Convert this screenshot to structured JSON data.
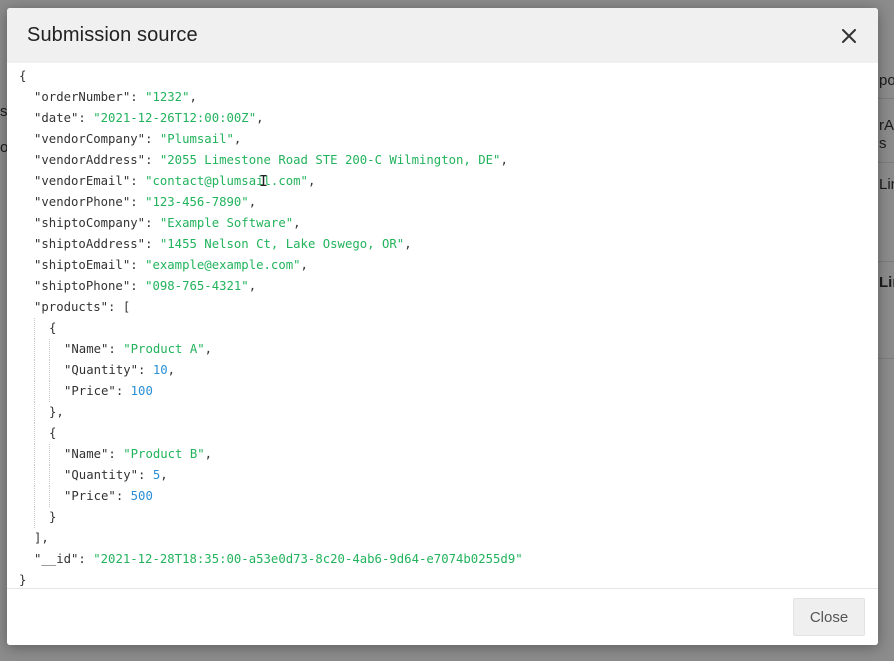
{
  "background": {
    "fragments": [
      "po",
      "rA",
      "s",
      "Lin",
      "Lin",
      "s",
      "o"
    ]
  },
  "modal": {
    "title": "Submission source",
    "close_button_label": "Close",
    "close_icon": "close-icon"
  },
  "json_source": {
    "lines": [
      {
        "depth": 0,
        "tokens": [
          {
            "t": "p",
            "v": "{"
          }
        ]
      },
      {
        "depth": 1,
        "tokens": [
          {
            "t": "k",
            "v": "\"orderNumber\""
          },
          {
            "t": "p",
            "v": ": "
          },
          {
            "t": "s",
            "v": "\"1232\""
          },
          {
            "t": "p",
            "v": ","
          }
        ]
      },
      {
        "depth": 1,
        "tokens": [
          {
            "t": "k",
            "v": "\"date\""
          },
          {
            "t": "p",
            "v": ": "
          },
          {
            "t": "s",
            "v": "\"2021-12-26T12:00:00Z\""
          },
          {
            "t": "p",
            "v": ","
          }
        ]
      },
      {
        "depth": 1,
        "tokens": [
          {
            "t": "k",
            "v": "\"vendorCompany\""
          },
          {
            "t": "p",
            "v": ": "
          },
          {
            "t": "s",
            "v": "\"Plumsail\""
          },
          {
            "t": "p",
            "v": ","
          }
        ]
      },
      {
        "depth": 1,
        "tokens": [
          {
            "t": "k",
            "v": "\"vendorAddress\""
          },
          {
            "t": "p",
            "v": ": "
          },
          {
            "t": "s",
            "v": "\"2055 Limestone Road STE 200-C Wilmington, DE\""
          },
          {
            "t": "p",
            "v": ","
          }
        ]
      },
      {
        "depth": 1,
        "tokens": [
          {
            "t": "k",
            "v": "\"vendorEmail\""
          },
          {
            "t": "p",
            "v": ": "
          },
          {
            "t": "s",
            "v": "\"contact@plumsail.com\""
          },
          {
            "t": "p",
            "v": ","
          }
        ]
      },
      {
        "depth": 1,
        "tokens": [
          {
            "t": "k",
            "v": "\"vendorPhone\""
          },
          {
            "t": "p",
            "v": ": "
          },
          {
            "t": "s",
            "v": "\"123-456-7890\""
          },
          {
            "t": "p",
            "v": ","
          }
        ]
      },
      {
        "depth": 1,
        "tokens": [
          {
            "t": "k",
            "v": "\"shiptoCompany\""
          },
          {
            "t": "p",
            "v": ": "
          },
          {
            "t": "s",
            "v": "\"Example Software\""
          },
          {
            "t": "p",
            "v": ","
          }
        ]
      },
      {
        "depth": 1,
        "tokens": [
          {
            "t": "k",
            "v": "\"shiptoAddress\""
          },
          {
            "t": "p",
            "v": ": "
          },
          {
            "t": "s",
            "v": "\"1455 Nelson Ct, Lake Oswego, OR\""
          },
          {
            "t": "p",
            "v": ","
          }
        ]
      },
      {
        "depth": 1,
        "tokens": [
          {
            "t": "k",
            "v": "\"shiptoEmail\""
          },
          {
            "t": "p",
            "v": ": "
          },
          {
            "t": "s",
            "v": "\"example@example.com\""
          },
          {
            "t": "p",
            "v": ","
          }
        ]
      },
      {
        "depth": 1,
        "tokens": [
          {
            "t": "k",
            "v": "\"shiptoPhone\""
          },
          {
            "t": "p",
            "v": ": "
          },
          {
            "t": "s",
            "v": "\"098-765-4321\""
          },
          {
            "t": "p",
            "v": ","
          }
        ]
      },
      {
        "depth": 1,
        "tokens": [
          {
            "t": "k",
            "v": "\"products\""
          },
          {
            "t": "p",
            "v": ": ["
          }
        ]
      },
      {
        "depth": 2,
        "tokens": [
          {
            "t": "p",
            "v": "{"
          }
        ]
      },
      {
        "depth": 3,
        "tokens": [
          {
            "t": "k",
            "v": "\"Name\""
          },
          {
            "t": "p",
            "v": ": "
          },
          {
            "t": "s",
            "v": "\"Product A\""
          },
          {
            "t": "p",
            "v": ","
          }
        ]
      },
      {
        "depth": 3,
        "tokens": [
          {
            "t": "k",
            "v": "\"Quantity\""
          },
          {
            "t": "p",
            "v": ": "
          },
          {
            "t": "n",
            "v": "10"
          },
          {
            "t": "p",
            "v": ","
          }
        ]
      },
      {
        "depth": 3,
        "tokens": [
          {
            "t": "k",
            "v": "\"Price\""
          },
          {
            "t": "p",
            "v": ": "
          },
          {
            "t": "n",
            "v": "100"
          }
        ]
      },
      {
        "depth": 2,
        "tokens": [
          {
            "t": "p",
            "v": "},"
          }
        ]
      },
      {
        "depth": 2,
        "tokens": [
          {
            "t": "p",
            "v": "{"
          }
        ]
      },
      {
        "depth": 3,
        "tokens": [
          {
            "t": "k",
            "v": "\"Name\""
          },
          {
            "t": "p",
            "v": ": "
          },
          {
            "t": "s",
            "v": "\"Product B\""
          },
          {
            "t": "p",
            "v": ","
          }
        ]
      },
      {
        "depth": 3,
        "tokens": [
          {
            "t": "k",
            "v": "\"Quantity\""
          },
          {
            "t": "p",
            "v": ": "
          },
          {
            "t": "n",
            "v": "5"
          },
          {
            "t": "p",
            "v": ","
          }
        ]
      },
      {
        "depth": 3,
        "tokens": [
          {
            "t": "k",
            "v": "\"Price\""
          },
          {
            "t": "p",
            "v": ": "
          },
          {
            "t": "n",
            "v": "500"
          }
        ]
      },
      {
        "depth": 2,
        "tokens": [
          {
            "t": "p",
            "v": "}"
          }
        ]
      },
      {
        "depth": 1,
        "tokens": [
          {
            "t": "p",
            "v": "],"
          }
        ]
      },
      {
        "depth": 1,
        "tokens": [
          {
            "t": "k",
            "v": "\"__id\""
          },
          {
            "t": "p",
            "v": ": "
          },
          {
            "t": "s",
            "v": "\"2021-12-28T18:35:00-a53e0d73-8c20-4ab6-9d64-e7074b0255d9\""
          }
        ]
      },
      {
        "depth": 0,
        "tokens": [
          {
            "t": "p",
            "v": "}"
          }
        ]
      }
    ]
  },
  "colors": {
    "string": "#22b35c",
    "number": "#2a8fd6",
    "key": "#333333",
    "header_bg": "#f0f0f0"
  }
}
